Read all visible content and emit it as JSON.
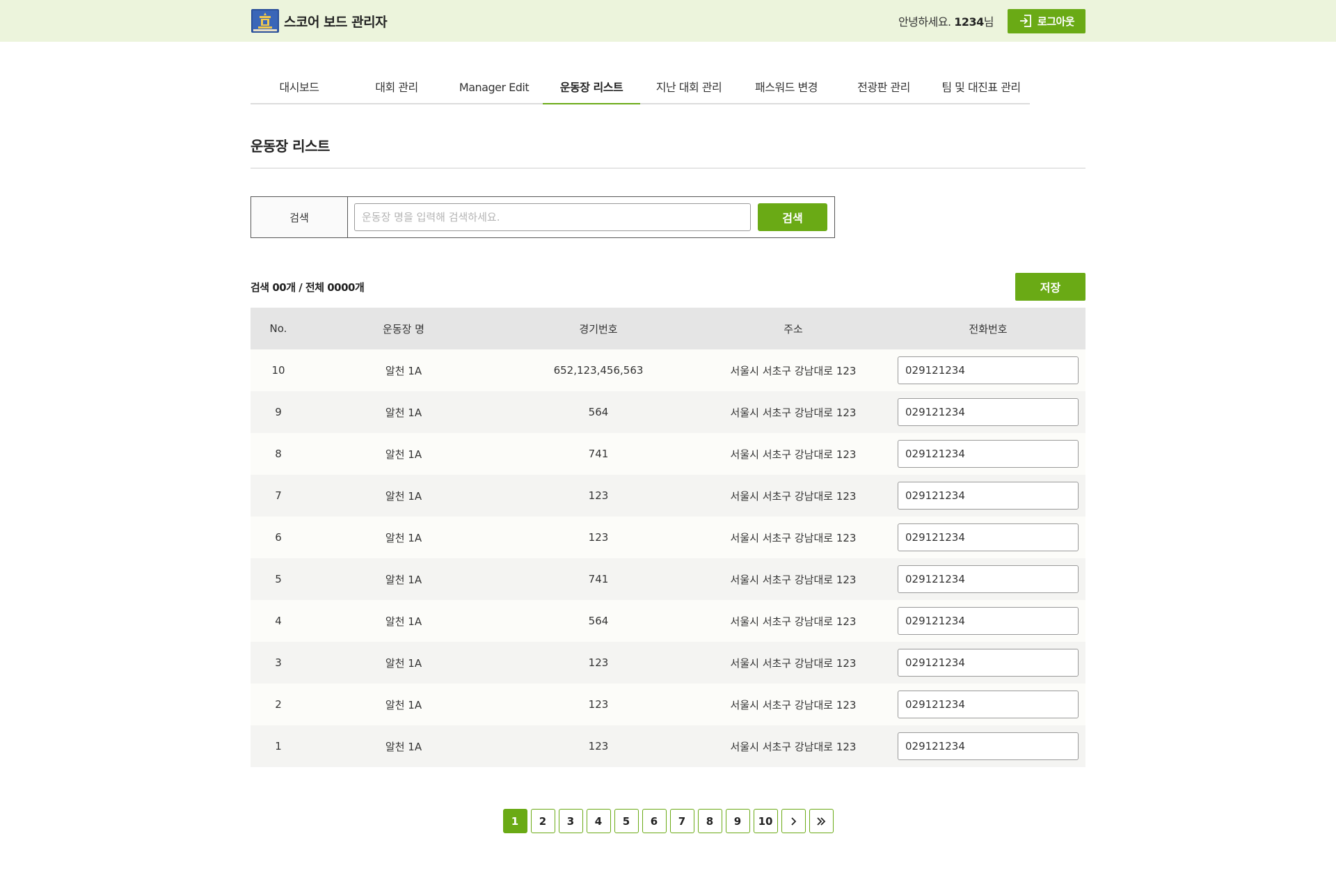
{
  "header": {
    "title": "스코어 보드 관리자",
    "greeting_prefix": "안녕하세요.",
    "user_name": "1234",
    "greeting_suffix": "님",
    "logout_label": "로그아웃"
  },
  "tabs": [
    {
      "label": "대시보드",
      "active": false
    },
    {
      "label": "대회 관리",
      "active": false
    },
    {
      "label": "Manager Edit",
      "active": false
    },
    {
      "label": "운동장 리스트",
      "active": true
    },
    {
      "label": "지난 대회 관리",
      "active": false
    },
    {
      "label": "패스워드 변경",
      "active": false
    },
    {
      "label": "전광판 관리",
      "active": false
    },
    {
      "label": "팀 및 대진표 관리",
      "active": false
    }
  ],
  "page_title": "운동장 리스트",
  "search": {
    "label": "검색",
    "placeholder": "운동장 명을 입력해 검색하세요.",
    "button": "검색"
  },
  "count_text": "검색 00개 / 전체 0000개",
  "save_label": "저장",
  "table": {
    "headers": [
      "No.",
      "운동장 명",
      "경기번호",
      "주소",
      "전화번호"
    ],
    "rows": [
      {
        "no": "10",
        "name": "알천 1A",
        "game": "652,123,456,563",
        "address": "서울시 서초구 강남대로 123",
        "phone": "029121234"
      },
      {
        "no": "9",
        "name": "알천 1A",
        "game": "564",
        "address": "서울시 서초구 강남대로 123",
        "phone": "029121234"
      },
      {
        "no": "8",
        "name": "알천 1A",
        "game": "741",
        "address": "서울시 서초구 강남대로 123",
        "phone": "029121234"
      },
      {
        "no": "7",
        "name": "알천 1A",
        "game": "123",
        "address": "서울시 서초구 강남대로 123",
        "phone": "029121234"
      },
      {
        "no": "6",
        "name": "알천 1A",
        "game": "123",
        "address": "서울시 서초구 강남대로 123",
        "phone": "029121234"
      },
      {
        "no": "5",
        "name": "알천 1A",
        "game": "741",
        "address": "서울시 서초구 강남대로 123",
        "phone": "029121234"
      },
      {
        "no": "4",
        "name": "알천 1A",
        "game": "564",
        "address": "서울시 서초구 강남대로 123",
        "phone": "029121234"
      },
      {
        "no": "3",
        "name": "알천 1A",
        "game": "123",
        "address": "서울시 서초구 강남대로 123",
        "phone": "029121234"
      },
      {
        "no": "2",
        "name": "알천 1A",
        "game": "123",
        "address": "서울시 서초구 강남대로 123",
        "phone": "029121234"
      },
      {
        "no": "1",
        "name": "알천 1A",
        "game": "123",
        "address": "서울시 서초구 강남대로 123",
        "phone": "029121234"
      }
    ]
  },
  "pagination": {
    "pages": [
      "1",
      "2",
      "3",
      "4",
      "5",
      "6",
      "7",
      "8",
      "9",
      "10"
    ],
    "current": "1",
    "next_icon": "chevron-right-icon",
    "last_icon": "double-chevron-right-icon"
  },
  "colors": {
    "accent": "#6aaa15",
    "header_bg": "#ecf4dc"
  }
}
